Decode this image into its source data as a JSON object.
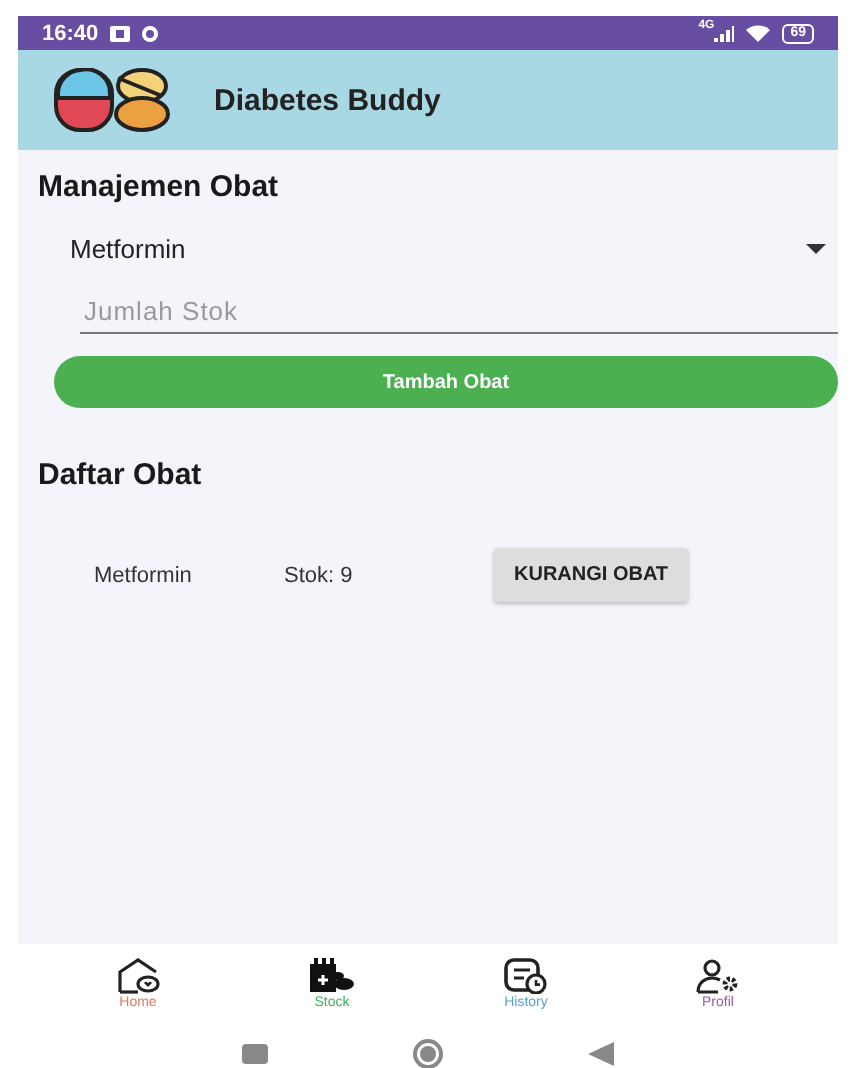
{
  "status_bar": {
    "time": "16:40",
    "network": "4G",
    "battery": "69"
  },
  "app_bar": {
    "title": "Diabetes Buddy"
  },
  "form": {
    "heading": "Manajemen Obat",
    "dropdown": {
      "value": "Metformin"
    },
    "stock_field": {
      "placeholder": "Jumlah Stok"
    },
    "button": "Tambah Obat"
  },
  "list": {
    "heading": "Daftar Obat",
    "items": [
      {
        "name": "Metformin",
        "stock": "Stok: 9",
        "button": "KURANGI OBAT"
      }
    ]
  },
  "bottom_nav": [
    {
      "kind": "home",
      "label": "Home",
      "color": "#e07a5a"
    },
    {
      "kind": "stock",
      "label": "Stock",
      "color": "#3fae5a"
    },
    {
      "kind": "history",
      "label": "History",
      "color": "#5a9fd0"
    },
    {
      "kind": "profile",
      "label": "Profil",
      "color": "#9a5ab0"
    }
  ]
}
